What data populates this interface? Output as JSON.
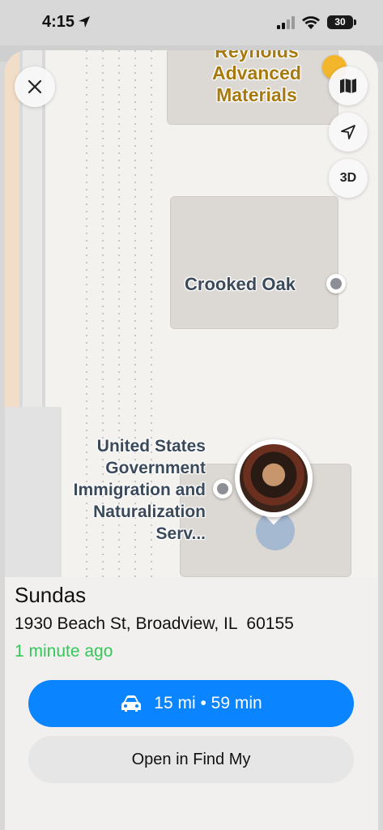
{
  "status_bar": {
    "time": "4:15",
    "battery": "30"
  },
  "map": {
    "labels": {
      "reynolds": "Reynolds\nAdvanced\nMaterials",
      "crooked_oak": "Crooked Oak",
      "uscis": "United States\nGovernment\nImmigration and\nNaturalization\nServ..."
    },
    "controls": {
      "three_d": "3D"
    },
    "colors": {
      "label_gold": "#a77a10",
      "label_slate": "#3b4a5b"
    }
  },
  "person": {
    "name": "Sundas",
    "address": "1930 Beach St, Broadview, IL  60155",
    "updated": "1 minute ago"
  },
  "actions": {
    "directions": "15 mi • 59 min",
    "open_findmy": "Open in Find My"
  },
  "colors": {
    "accent_blue": "#0a84ff",
    "status_green": "#34c759"
  },
  "icons": [
    "location-arrow-icon",
    "signal-icon",
    "wifi-icon",
    "battery-icon",
    "close-icon",
    "map-icon",
    "location-icon",
    "car-icon"
  ]
}
